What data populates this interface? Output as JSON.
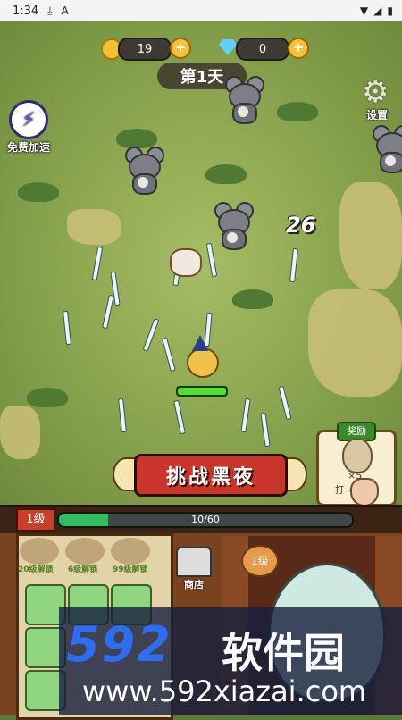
{
  "status_bar": {
    "time": "1:34"
  },
  "resources": {
    "coins": "19",
    "gems": "0"
  },
  "day_label": "第1天",
  "side": {
    "speed_label": "免费加速",
    "settings_label": "设置"
  },
  "damage_number": "26",
  "challenge_button": "挑战黑夜",
  "reward": {
    "tag": "奖励",
    "count": "×5",
    "desc": "打 +3个蛋"
  },
  "level": {
    "badge": "1级",
    "xp_text": "10/60",
    "xp_fraction": 0.1667
  },
  "unlocks": [
    "20级解锁",
    "6级解锁",
    "99级解锁"
  ],
  "shop_label": "商店",
  "stage_level": "1级",
  "watermark": {
    "big": "592",
    "cn": "软件园",
    "url": "www.592xiazai.com"
  },
  "colors": {
    "xp_fill": "#2fbf60",
    "challenge_bg": "#c9352a",
    "hp": "#50e030"
  }
}
